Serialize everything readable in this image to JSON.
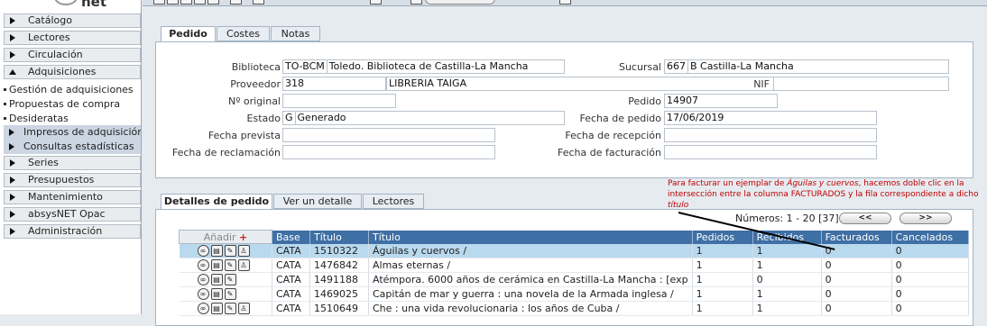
{
  "app": {
    "logo_text": "net"
  },
  "sidebar": {
    "items": [
      {
        "label": "Catálogo"
      },
      {
        "label": "Lectores"
      },
      {
        "label": "Circulación"
      },
      {
        "label": "Adquisiciones"
      },
      {
        "label": "Series"
      },
      {
        "label": "Presupuestos"
      },
      {
        "label": "Mantenimiento"
      },
      {
        "label": "absysNET Opac"
      },
      {
        "label": "Administración"
      }
    ],
    "adquisiciones_sub": [
      {
        "label": "Gestión de adquisiciones"
      },
      {
        "label": "Propuestas de compra"
      },
      {
        "label": "Desideratas"
      }
    ],
    "adquisiciones_groups": [
      {
        "label": "Impresos de adquisición"
      },
      {
        "label": "Consultas estadísticas"
      }
    ]
  },
  "top_tabs": [
    {
      "label": "Pedido"
    },
    {
      "label": "Costes"
    },
    {
      "label": "Notas"
    }
  ],
  "form": {
    "biblioteca": {
      "label": "Biblioteca",
      "code": "TO-BCM",
      "value": "Toledo. Biblioteca de Castilla-La Mancha"
    },
    "sucursal": {
      "label": "Sucursal",
      "code": "667",
      "value": "B Castilla-La Mancha"
    },
    "proveedor": {
      "label": "Proveedor",
      "code": "318",
      "value": "LIBRERIA TAIGA"
    },
    "nif": {
      "label": "NIF",
      "value": ""
    },
    "n_original": {
      "label": "Nº original",
      "value": ""
    },
    "pedido": {
      "label": "Pedido",
      "value": "14907"
    },
    "estado": {
      "label": "Estado",
      "code": "G",
      "value": "Generado"
    },
    "fecha_pedido": {
      "label": "Fecha de pedido",
      "value": "17/06/2019"
    },
    "fecha_prevista": {
      "label": "Fecha prevista",
      "value": ""
    },
    "fecha_recepcion": {
      "label": "Fecha de recepción",
      "value": ""
    },
    "fecha_reclamacion": {
      "label": "Fecha de reclamación",
      "value": ""
    },
    "fecha_facturacion": {
      "label": "Fecha de facturación",
      "value": ""
    }
  },
  "bottom_tabs": [
    {
      "label": "Detalles de pedido"
    },
    {
      "label": "Ver un detalle"
    },
    {
      "label": "Lectores"
    }
  ],
  "annotation": {
    "part1": "Para facturar un ejemplar de ",
    "title1": "Águilas y cuervos",
    "part2": ", hacemos doble clic en la intersección entre la columna FACTURADOS y la fila correspondiente a dicho ",
    "title2": "título"
  },
  "pager": {
    "text": "Números: 1 - 20 [37]",
    "prev": "<<",
    "next": ">>"
  },
  "table": {
    "add_label": "Añadir",
    "add_plus": "+",
    "headers": [
      "Base",
      "Título",
      "Título",
      "Pedidos",
      "Recibidos",
      "Facturados",
      "Cancelados"
    ],
    "rows": [
      {
        "icons": 4,
        "base": "CATA",
        "id": "1510322",
        "titulo": "Águilas y cuervos /",
        "pedidos": "1",
        "recibidos": "1",
        "facturados": "0",
        "cancelados": "0"
      },
      {
        "icons": 4,
        "base": "CATA",
        "id": "1476842",
        "titulo": "Almas eternas /",
        "pedidos": "1",
        "recibidos": "1",
        "facturados": "0",
        "cancelados": "0"
      },
      {
        "icons": 3,
        "base": "CATA",
        "id": "1491188",
        "titulo": "Atémpora. 6000 años de cerámica en Castilla-La Mancha : [exp",
        "pedidos": "1",
        "recibidos": "0",
        "facturados": "0",
        "cancelados": "0"
      },
      {
        "icons": 3,
        "base": "CATA",
        "id": "1469025",
        "titulo": "Capitán de mar y guerra : una novela de la Armada inglesa /",
        "pedidos": "1",
        "recibidos": "1",
        "facturados": "0",
        "cancelados": "0"
      },
      {
        "icons": 4,
        "base": "CATA",
        "id": "1510649",
        "titulo": "Che : una vida revolucionaria : los años de Cuba /",
        "pedidos": "1",
        "recibidos": "1",
        "facturados": "0",
        "cancelados": "0"
      }
    ]
  }
}
